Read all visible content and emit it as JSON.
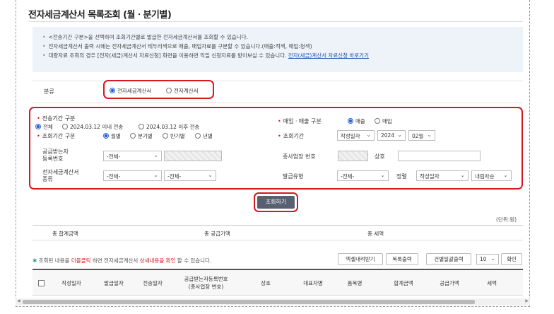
{
  "page_title": "전자세금계산서 목록조회 (월ㆍ분기별)",
  "notices": [
    "<전송기간 구분>을 선택하여 조회기간별로 발급한 전자세금계산서를 조회할 수 있습니다.",
    "전자세금계산서 출력 시에는 전자세금계산서 테두리색으로 매출, 매입자료를 구분할 수 있습니다.(매출:적색, 매입:청색)",
    "대량자료 조회의 경우 [전자(세금)계산서 자료신청] 화면을 이용하면 익일 신청자료를 받아보실 수 있습니다."
  ],
  "notice_link": "전자(세금)계산서 자료신청 바로가기",
  "category": {
    "label": "분류",
    "options": [
      "전자세금계산서",
      "전자계산서"
    ],
    "selected": 0
  },
  "transmission_period": {
    "label": "전송기간 구분",
    "options": [
      "전체",
      "2024.03.12 이내 전송",
      "2024.03.12 이후 전송"
    ],
    "selected": 0
  },
  "sales_purchase": {
    "label": "매입ㆍ매출 구분",
    "options": [
      "매출",
      "매입"
    ],
    "selected": 0
  },
  "inquiry_period_type": {
    "label": "조회기간 구분",
    "options": [
      "월별",
      "분기별",
      "반기별",
      "년별"
    ],
    "selected": 0
  },
  "inquiry_period": {
    "label": "조회기간",
    "date_type": "작성일자",
    "year": "2024",
    "month": "02월"
  },
  "recipient_reg_no": {
    "label_line1": "공급받는자",
    "label_line2": "등록번호",
    "select": "-전체-"
  },
  "branch_no": {
    "label": "종사업장 번호"
  },
  "company_name": {
    "label": "상호"
  },
  "invoice_type": {
    "label_line1": "전자세금계산서",
    "label_line2": "종류",
    "select1": "-전체-",
    "select2": "-전체-"
  },
  "issue_type": {
    "label": "발급유형",
    "select": "-전체-"
  },
  "sort": {
    "label": "정렬",
    "field": "작성일자",
    "order": "내림차순"
  },
  "search_button": "조회하기",
  "unit_text": "(단위:원)",
  "summary": {
    "total_label": "총 합계금액",
    "supply_label": "총 공급가액",
    "tax_label": "총 세액"
  },
  "info_parts": [
    "조회된 내용을 ",
    "더블클릭",
    " 하면 전자세금계산서 ",
    "상세내용을 확인",
    " 할 수 있습니다."
  ],
  "toolbar": {
    "excel": "엑셀내려받기",
    "print_list": "목록출력",
    "bulk_print": "건별일괄출력",
    "page_size": "10",
    "confirm": "확인"
  },
  "table_headers": {
    "col1": "작성일자",
    "col2": "발급일자",
    "col3": "전송일자",
    "col4_line1": "공급받는자등록번호",
    "col4_line2": "(종사업장 번호)",
    "col5": "상호",
    "col6": "대표자명",
    "col7": "품목명",
    "col8": "합계금액",
    "col9": "공급가액",
    "col10": "세액"
  },
  "colors": {
    "accent_red": "#d7181f",
    "radio_blue": "#2a62d8",
    "link_blue": "#2351b8",
    "search_btn": "#585f70"
  }
}
